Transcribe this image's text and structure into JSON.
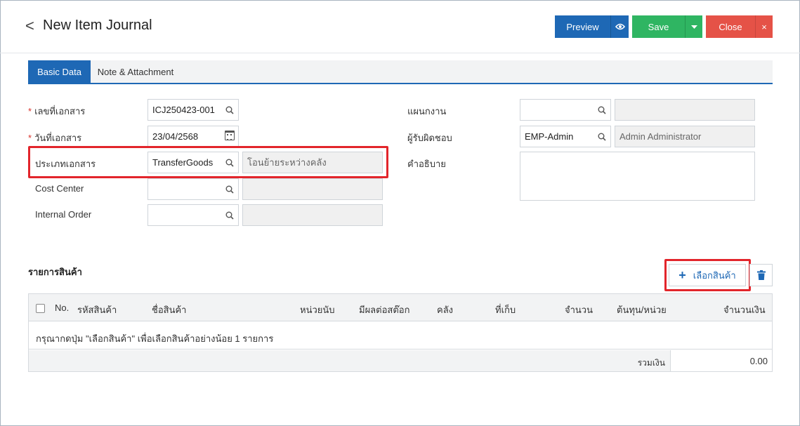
{
  "header": {
    "back_glyph": "<",
    "title": "New Item Journal",
    "preview_label": "Preview",
    "save_label": "Save",
    "close_label": "Close",
    "close_x": "×"
  },
  "tabs": [
    {
      "label": "Basic Data",
      "active": true
    },
    {
      "label": "Note & Attachment",
      "active": false
    }
  ],
  "form": {
    "doc_no": {
      "label": "เลขที่เอกสาร",
      "required": "*",
      "value": "ICJ250423-001"
    },
    "doc_date": {
      "label": "วันที่เอกสาร",
      "required": "*",
      "value": "23/04/2568"
    },
    "doc_type": {
      "label": "ประเภทเอกสาร",
      "value": "TransferGoods",
      "desc": "โอนย้ายระหว่างคลัง"
    },
    "cost_center": {
      "label": "Cost Center",
      "value": "",
      "desc": ""
    },
    "internal_order": {
      "label": "Internal Order",
      "value": "",
      "desc": ""
    },
    "department": {
      "label": "แผนกงาน",
      "value": "",
      "desc": ""
    },
    "responsible": {
      "label": "ผู้รับผิดชอบ",
      "value": "EMP-Admin",
      "desc": "Admin Administrator"
    },
    "description": {
      "label": "คำอธิบาย",
      "value": ""
    }
  },
  "items": {
    "section_title": "รายการสินค้า",
    "select_button": "เลือกสินค้า",
    "columns": [
      "No.",
      "รหัสสินค้า",
      "ชื่อสินค้า",
      "หน่วยนับ",
      "มีผลต่อสต๊อก",
      "คลัง",
      "ที่เก็บ",
      "จำนวน",
      "ต้นทุน/หน่วย",
      "จำนวนเงิน"
    ],
    "empty_message": "กรุณากดปุ่ม \"เลือกสินค้า\" เพื่อเลือกสินค้าอย่างน้อย 1 รายการ",
    "total_label": "รวมเงิน",
    "total_value": "0.00"
  },
  "colors": {
    "primary": "#1e68b5",
    "success": "#2fb562",
    "danger": "#e55247",
    "highlight": "#e2252b"
  }
}
